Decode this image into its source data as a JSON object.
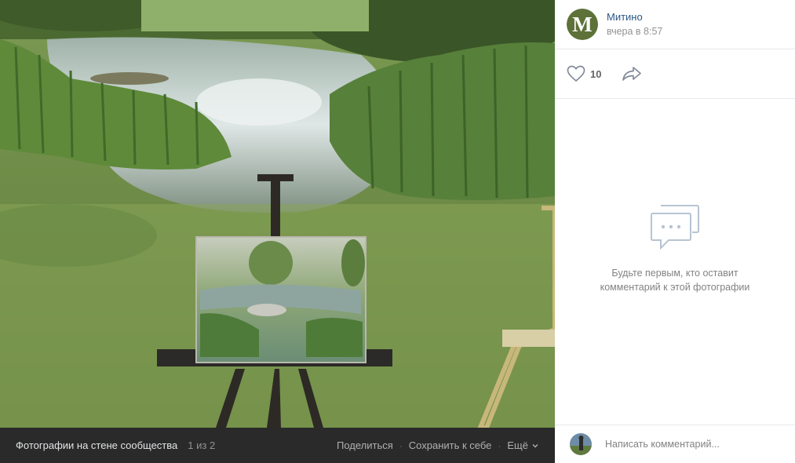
{
  "photo": {
    "alt_icon": "photo-of-easel-by-pond"
  },
  "bottom_bar": {
    "title": "Фотографии на стене сообщества",
    "counter": "1 из 2",
    "share_label": "Поделиться",
    "save_label": "Сохранить к себе",
    "more_label": "Ещё",
    "separator": "·"
  },
  "author": {
    "name": "Митино",
    "time": "вчера в 8:57",
    "avatar_letter": "M"
  },
  "actions": {
    "likes_count": "10",
    "like_icon": "heart-icon",
    "share_icon": "share-arrow-icon"
  },
  "comments": {
    "empty_text": "Будьте первым, кто оставит комментарий к этой фотографии",
    "input_placeholder": "Написать комментарий..."
  },
  "colors": {
    "link": "#2a5885",
    "bar_bg": "#2a2a2a",
    "muted": "#828282"
  }
}
